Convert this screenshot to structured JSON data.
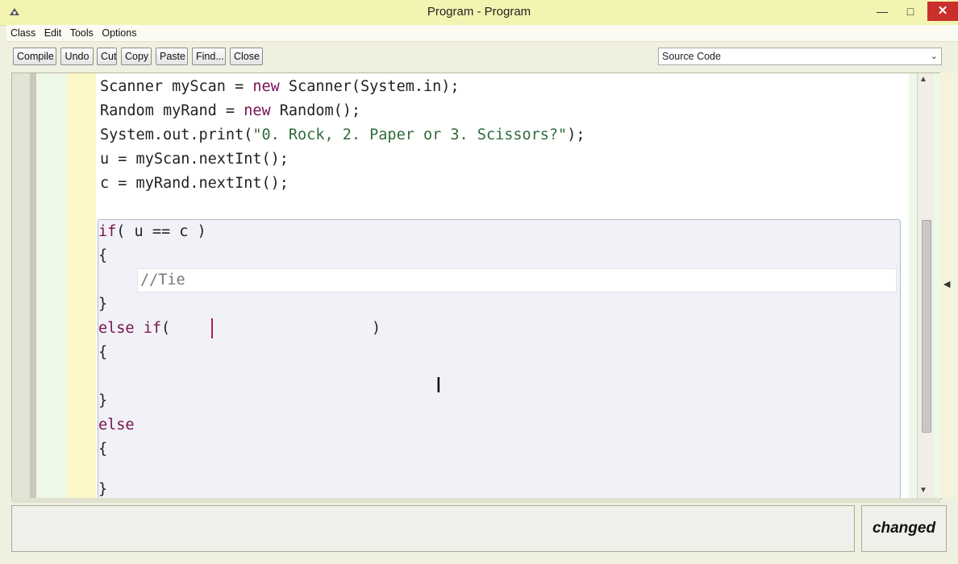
{
  "window": {
    "title": "Program - Program"
  },
  "menu": {
    "items": [
      "Class",
      "Edit",
      "Tools",
      "Options"
    ]
  },
  "toolbar": {
    "buttons": [
      "Compile",
      "Undo",
      "Cut",
      "Copy",
      "Paste",
      "Find...",
      "Close"
    ],
    "view_select": "Source Code"
  },
  "code": {
    "line1": {
      "a": "Scanner myScan = ",
      "kw": "new",
      "b": " Scanner(System.in);"
    },
    "line2": {
      "a": "Random myRand = ",
      "kw": "new",
      "b": " Random();"
    },
    "line3": {
      "a": "System.out.print(",
      "str": "\"0. Rock, 2. Paper or 3. Scissors?\"",
      "b": ");"
    },
    "line4": "u = myScan.nextInt();",
    "line5": "c = myRand.nextInt();",
    "if_kw": "if",
    "if_cond": "( u == c )",
    "open_brace": "{",
    "close_brace": "}",
    "comment": "//Tie",
    "elseif_kw": "else if",
    "elseif_open": "(",
    "elseif_close": ")",
    "else_kw": "else"
  },
  "status": {
    "message": "",
    "state": "changed"
  }
}
